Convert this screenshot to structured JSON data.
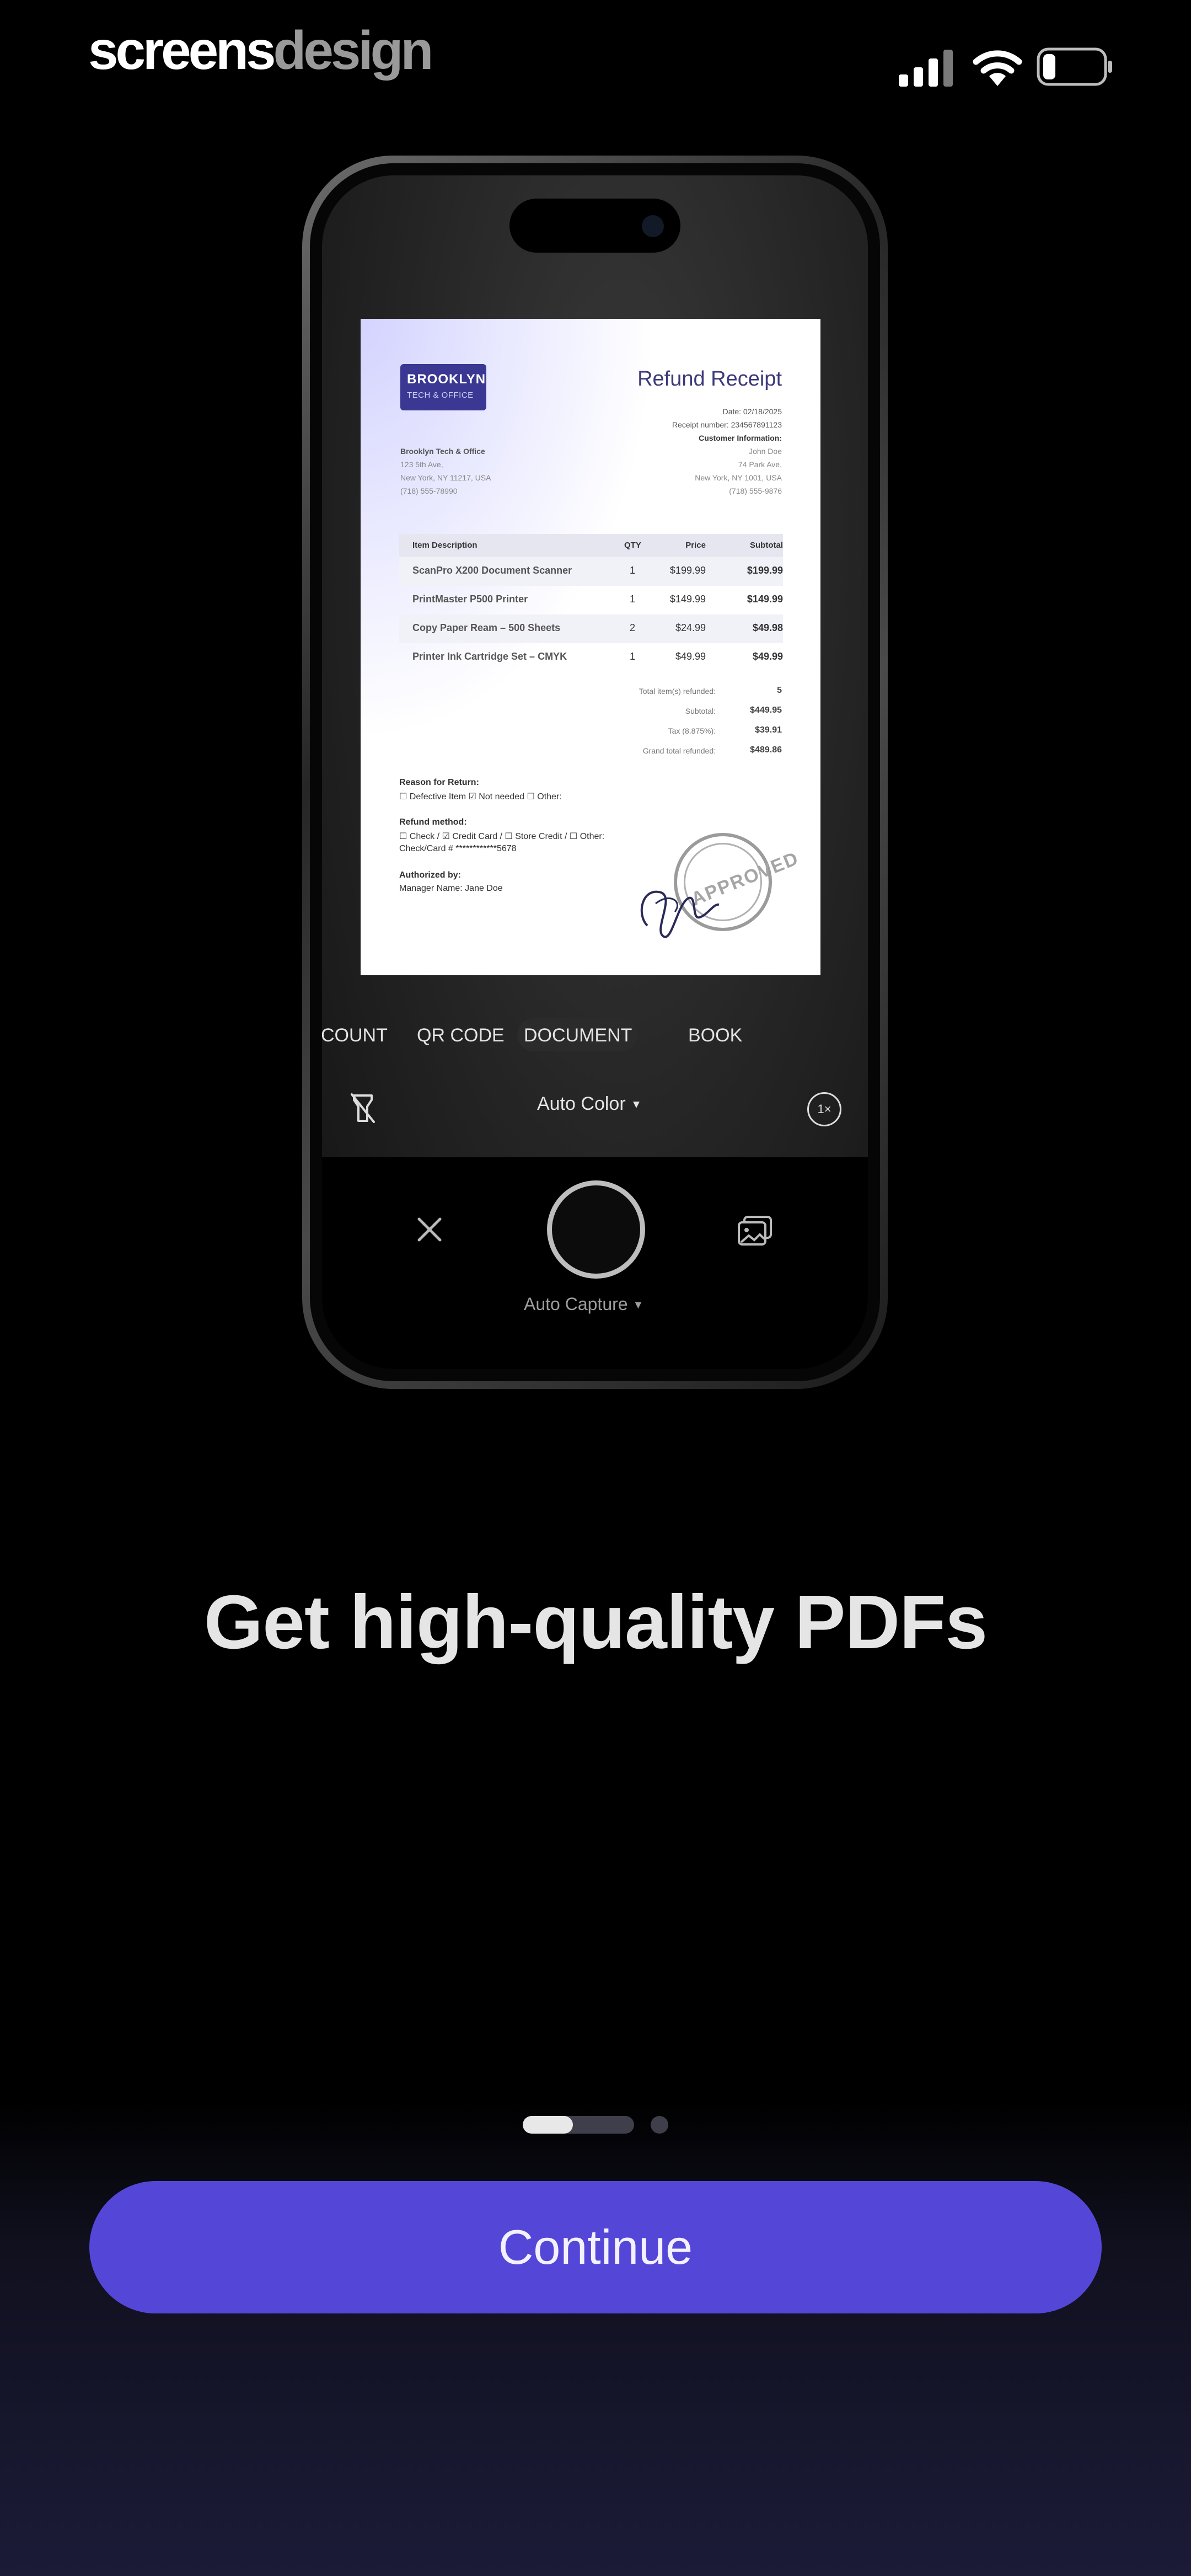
{
  "watermark": {
    "part1": "screens",
    "part2": "design"
  },
  "status_bar": {
    "icons": [
      "cellular-signal-icon",
      "wifi-icon",
      "battery-icon"
    ]
  },
  "receipt": {
    "logo_line1": "BROOKLYN",
    "logo_line2": "TECH & OFFICE",
    "title": "Refund Receipt",
    "date": "Date: 02/18/2025",
    "receipt_number": "Receipt number: 234567891123",
    "customer_heading": "Customer Information:",
    "customer_name": "John Doe",
    "customer_street": "74 Park Ave,",
    "customer_city": "New York, NY 1001, USA",
    "customer_phone": "(718) 555-9876",
    "company_name": "Brooklyn Tech & Office",
    "company_street": "123 5th Ave,",
    "company_city": "New York, NY 11217, USA",
    "company_phone": "(718) 555-78990",
    "columns": [
      "Item Description",
      "QTY",
      "Price",
      "Subtotal"
    ],
    "items": [
      {
        "desc": "ScanPro X200 Document Scanner",
        "qty": "1",
        "price": "$199.99",
        "subtotal": "$199.99"
      },
      {
        "desc": "PrintMaster P500 Printer",
        "qty": "1",
        "price": "$149.99",
        "subtotal": "$149.99"
      },
      {
        "desc": "Copy Paper Ream – 500 Sheets",
        "qty": "2",
        "price": "$24.99",
        "subtotal": "$49.98"
      },
      {
        "desc": "Printer Ink Cartridge Set – CMYK",
        "qty": "1",
        "price": "$49.99",
        "subtotal": "$49.99"
      }
    ],
    "totals": [
      {
        "label": "Total item(s) refunded:",
        "value": "5"
      },
      {
        "label": "Subtotal:",
        "value": "$449.95"
      },
      {
        "label": "Tax (8.875%):",
        "value": "$39.91"
      },
      {
        "label": "Grand total refunded:",
        "value": "$489.86"
      }
    ],
    "reason_heading": "Reason for Return:",
    "reason_options": "☐ Defective Item ☑ Not needed ☐ Other:",
    "method_heading": "Refund method:",
    "method_options": "☐ Check / ☑ Credit Card / ☐ Store Credit / ☐ Other:",
    "card_line": "Check/Card # ************5678",
    "authorized_heading": "Authorized by:",
    "authorized_name": "Manager Name: Jane Doe",
    "stamp_text": "APPROVED"
  },
  "camera": {
    "modes": [
      "COUNT",
      "QR CODE",
      "DOCUMENT",
      "BOOK"
    ],
    "selected_mode": "DOCUMENT",
    "color_mode": "Auto Color",
    "zoom": "1×",
    "capture_mode": "Auto Capture"
  },
  "onboarding": {
    "headline": "Get high-quality PDFs",
    "page_count": 2,
    "current_page": 1,
    "current_page_progress": 0.45,
    "continue_label": "Continue"
  },
  "colors": {
    "accent": "#5447d8",
    "background": "#000000",
    "headline": "#e5e5e5"
  }
}
